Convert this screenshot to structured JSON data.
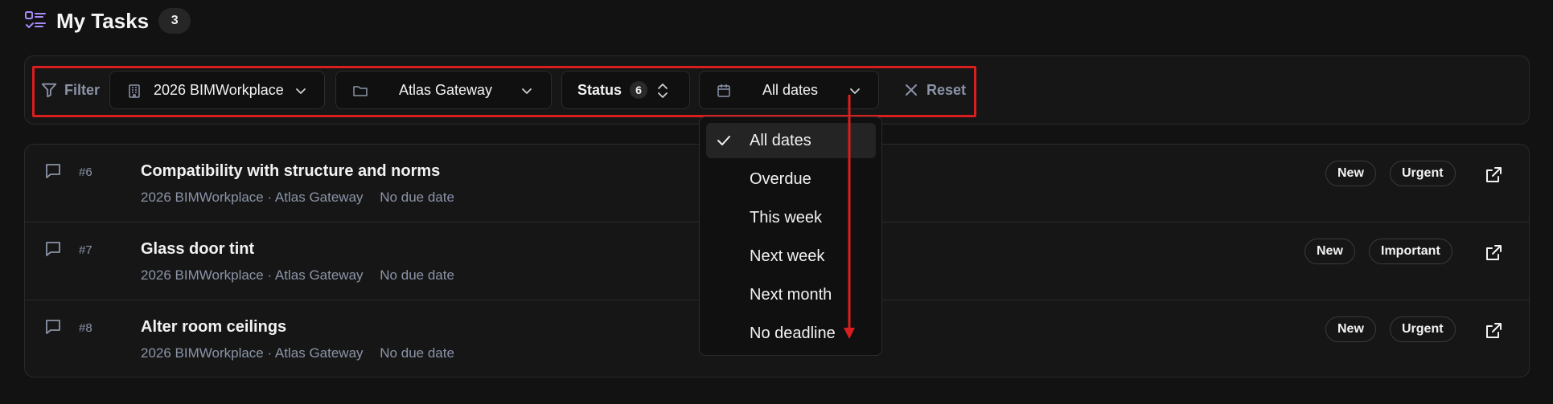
{
  "header": {
    "title": "My Tasks",
    "count": "3",
    "icon": "checklist-icon"
  },
  "filter": {
    "label": "Filter",
    "project": "2026 BIMWorkplace",
    "site": "Atlas Gateway",
    "status_label": "Status",
    "status_count": "6",
    "dates": "All dates",
    "reset": "Reset"
  },
  "date_menu": {
    "items": [
      "All dates",
      "Overdue",
      "This week",
      "Next week",
      "Next month",
      "No deadline"
    ],
    "selected": "All dates"
  },
  "tasks": [
    {
      "id": "#6",
      "title": "Compatibility with structure and norms",
      "meta": "2026 BIMWorkplace · Atlas Gateway",
      "due": "No due date",
      "tags": [
        "New",
        "Urgent"
      ]
    },
    {
      "id": "#7",
      "title": "Glass door tint",
      "meta": "2026 BIMWorkplace · Atlas Gateway",
      "due": "No due date",
      "tags": [
        "New",
        "Important"
      ]
    },
    {
      "id": "#8",
      "title": "Alter room ceilings",
      "meta": "2026 BIMWorkplace · Atlas Gateway",
      "due": "No due date",
      "tags": [
        "New",
        "Urgent"
      ]
    }
  ],
  "colors": {
    "background": "#121212",
    "panel": "#161616",
    "accent": "#8b94a7",
    "highlight": "#d81e1e",
    "icon_purple": "#a78bfa"
  }
}
